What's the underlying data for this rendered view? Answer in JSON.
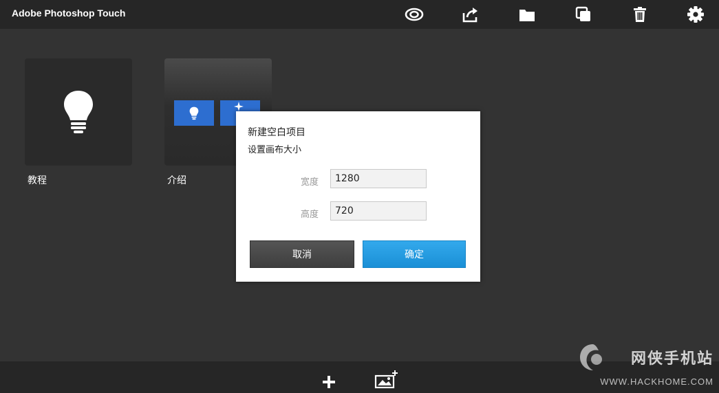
{
  "app": {
    "title": "Adobe Photoshop Touch"
  },
  "toolbar": {
    "icons": [
      "creative-cloud-icon",
      "share-icon",
      "folder-icon",
      "duplicate-icon",
      "trash-icon",
      "gear-icon"
    ]
  },
  "projects": [
    {
      "label": "教程",
      "icon": "lightbulb-icon"
    },
    {
      "label": "介绍",
      "icon": "tutorial-preview-icon"
    }
  ],
  "dialog": {
    "title": "新建空白项目",
    "subtitle": "设置画布大小",
    "width_label": "宽度",
    "width_value": "1280",
    "height_label": "高度",
    "height_value": "720",
    "cancel_label": "取消",
    "ok_label": "确定"
  },
  "bottombar": {
    "icons": [
      "plus-icon",
      "add-image-icon"
    ]
  },
  "watermark": {
    "text": "网侠手机站",
    "url": "WWW.HACKHOME.COM"
  },
  "colors": {
    "background": "#333333",
    "topbar": "#262626",
    "accent": "#1a8fd6",
    "tile_blue": "#2d6ed0"
  }
}
